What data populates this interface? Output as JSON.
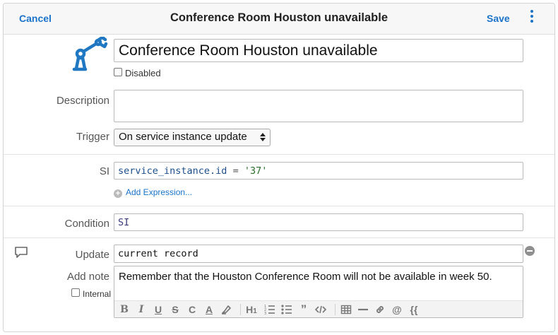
{
  "header": {
    "cancel_label": "Cancel",
    "title": "Conference Room Houston unavailable",
    "save_label": "Save",
    "menu_icon": "vertical-ellipsis-icon"
  },
  "form": {
    "logo_icon": "robot-arm-icon",
    "name_value": "Conference Room Houston unavailable",
    "disabled_label": "Disabled",
    "disabled_checked": false,
    "description_label": "Description",
    "description_value": "",
    "trigger_label": "Trigger",
    "trigger_value": "On service instance update",
    "si_label": "SI",
    "si_expression": {
      "field": "service_instance.id",
      "operator": "=",
      "value": "'37'"
    },
    "add_expression_label": "Add Expression...",
    "condition_label": "Condition",
    "condition_value": "SI",
    "update_label": "Update",
    "update_value": "current record",
    "add_note_label": "Add note",
    "internal_label": "Internal",
    "internal_checked": false,
    "note_value": "Remember that the Houston Conference Room will not be available in week 50."
  },
  "toolbar": [
    {
      "name": "bold-button",
      "glyph": "B"
    },
    {
      "name": "italic-button",
      "glyph": "I"
    },
    {
      "name": "underline-button",
      "glyph": "U"
    },
    {
      "name": "strikethrough-button",
      "glyph": "S"
    },
    {
      "name": "clear-format-button",
      "glyph": "C"
    },
    {
      "name": "text-color-button",
      "glyph": "A"
    },
    {
      "name": "highlight-button",
      "glyph": "highlighter-icon"
    },
    {
      "name": "heading-button",
      "glyph": "H1"
    },
    {
      "name": "numbered-list-button",
      "glyph": "ordered-list-icon"
    },
    {
      "name": "bullet-list-button",
      "glyph": "bullet-list-icon"
    },
    {
      "name": "quote-button",
      "glyph": "quote-icon"
    },
    {
      "name": "code-button",
      "glyph": "code-icon"
    },
    {
      "name": "table-button",
      "glyph": "table-icon"
    },
    {
      "name": "horizontal-rule-button",
      "glyph": "rule-icon"
    },
    {
      "name": "link-button",
      "glyph": "link-icon"
    },
    {
      "name": "mention-button",
      "glyph": "@"
    },
    {
      "name": "template-button",
      "glyph": "{{"
    }
  ],
  "colors": {
    "accent": "#1a73c9",
    "logo": "#1f78c1",
    "code_text": "#1d4e89",
    "code_string": "#2a6e2a"
  }
}
